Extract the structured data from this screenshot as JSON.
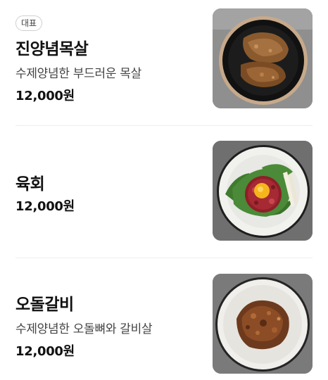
{
  "menu": {
    "items": [
      {
        "badge": "대표",
        "name": "진양념목살",
        "description": "수제양념한 부드러운 목살",
        "price": "12,000원",
        "image_icon": "marinated-pork-neck-in-black-pan"
      },
      {
        "name": "육회",
        "price": "12,000원",
        "image_icon": "beef-tartare-with-egg-yolk-on-perilla-leaves"
      },
      {
        "name": "오돌갈비",
        "description": "수제양념한 오돌뼈와 갈비살",
        "price": "12,000원",
        "image_icon": "marinated-rib-cartilage-on-plate"
      }
    ]
  }
}
